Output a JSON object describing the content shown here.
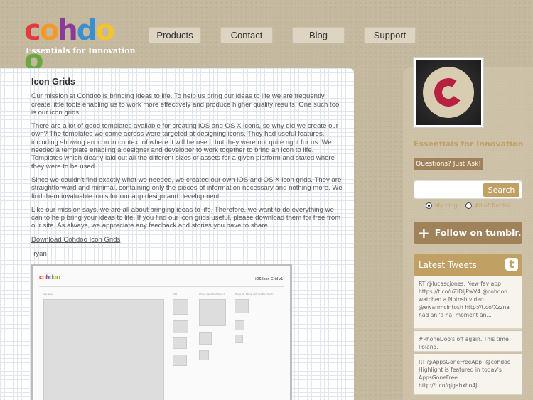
{
  "brand": {
    "logo_text": "cohdoo",
    "logo_letters": [
      {
        "char": "c",
        "color": "#e23b3c"
      },
      {
        "char": "o",
        "color": "#f39a2a"
      },
      {
        "char": "h",
        "color": "#8c3a98"
      },
      {
        "char": "d",
        "color": "#3a8fcf"
      },
      {
        "char": "o",
        "color": "#f6c22e"
      },
      {
        "char": "o",
        "color": "#6aa842"
      }
    ],
    "tagline": "Essentials for Innovation"
  },
  "nav": {
    "items": [
      "Products",
      "Contact",
      "Blog",
      "Support"
    ]
  },
  "article": {
    "title": "Icon Grids",
    "paragraphs": [
      "Our mission at Cohdoo is bringing ideas to life. To help us bring our ideas to life we are frequently create little tools enabling us to work more effectively and produce higher quality results. One such tool is our icon grids.",
      "There are a lot of good templates available for creating iOS and OS X icons, so why did we create our own? The templates we came across were targeted at designing icons. They had useful features, including showing an icon in context of where it will be used, but they were not quite right for us. We needed a template enabling a designer and developer to work together to bring an icon to life. Templates which clearly laid out all the different sizes of assets for a given platform and stated where they were to be used.",
      "Since we couldn't find exactly what we needed, we created our own iOS and OS X icon grids. They are straightforward and minimal, containing only the pieces of information necessary and nothing more. We find them invaluable tools for our app design and development.",
      "Like our mission says, we are all about bringing ideas to life. Therefore, we want to do everything we can to help bring your ideas to life. If you find our icon grids useful, please download them for free from our site. As always, we appreciate any feedback and stories you have to share."
    ],
    "download_link": "Download Cohdoo Icon Grids",
    "signature": "-ryan",
    "preview": {
      "logo": "cohdoo",
      "title": "iOS Icon Grid v1",
      "columns": [
        "App Store",
        "iPad",
        "iPhone 4 and iPod Touch 4",
        "iPhone 3G, iPhone 3GS and iPod Touch 3"
      ]
    }
  },
  "sidebar": {
    "title": "Essentials for Innovation",
    "ask_button": "Questions? Just Ask!",
    "search": {
      "placeholder": "",
      "button": "Search",
      "option_blog": "My blog",
      "option_all": "All of Tumblr"
    },
    "follow_button": "Follow on tumblr.",
    "tweets_header": "Latest Tweets",
    "tweets": [
      "RT @lucascjones: New fav app https://t.co/uZiDlJPwV4 @cohdoo watched a Notosh video @ewanmcintosh http://t.co/Xzzna had an 'a ha' moment an...",
      "#PhoneDoo's off again. This time Poland.",
      "RT @AppsGoneFreeApp: @cohdoo Highlight is featured in today's AppsGoneFree: http://t.co/qJgahxho4J"
    ]
  }
}
